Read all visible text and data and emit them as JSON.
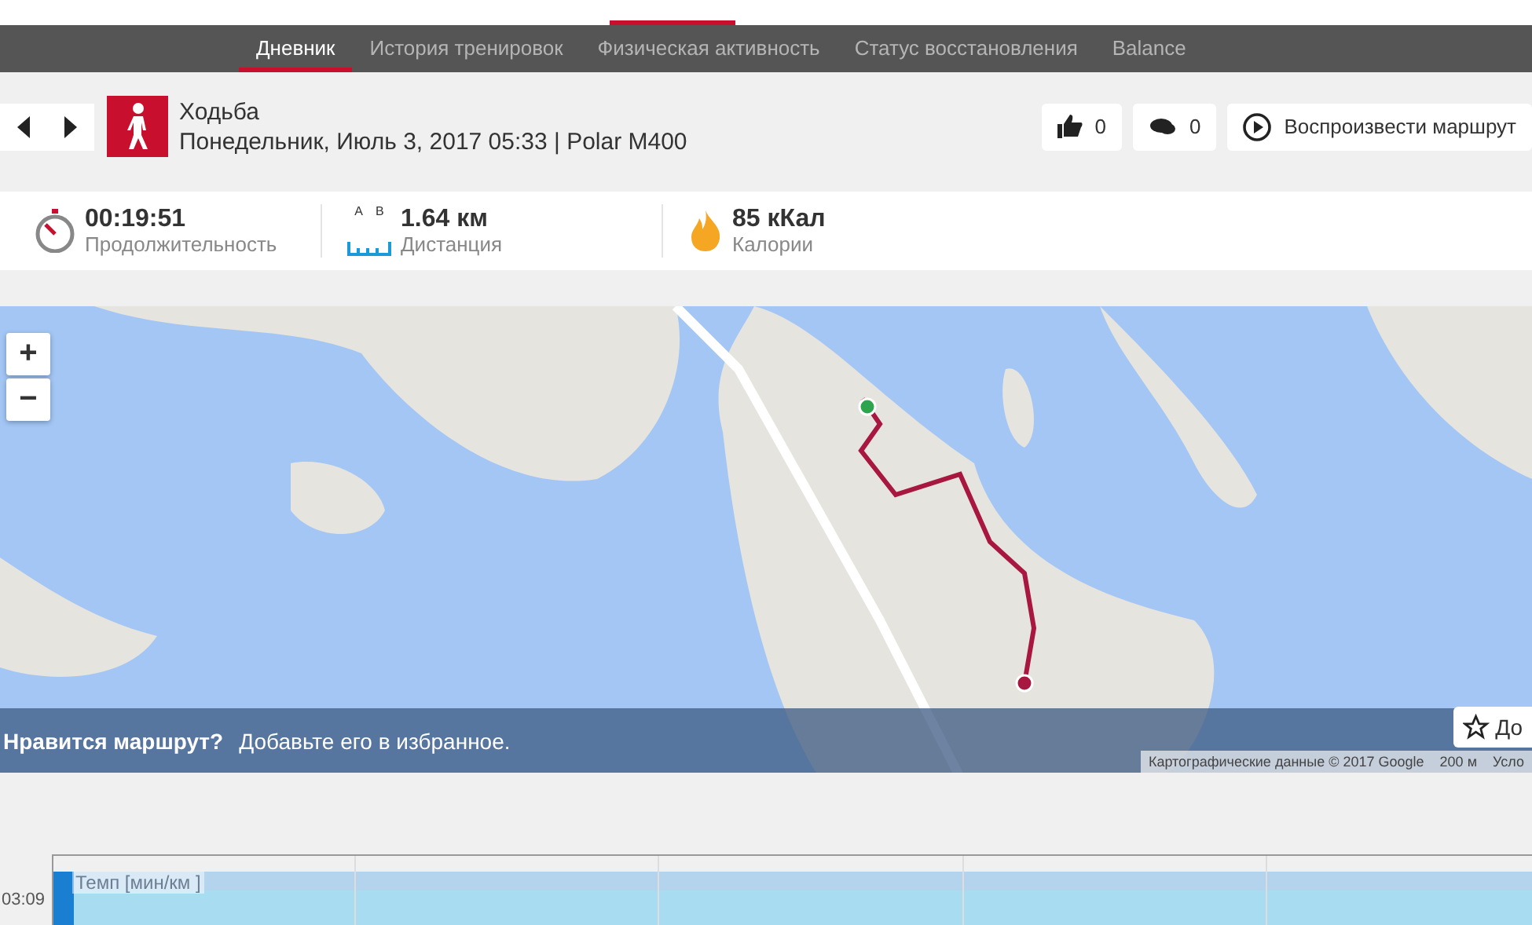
{
  "tabs": [
    {
      "label": "Дневник",
      "selected": true
    },
    {
      "label": "История тренировок",
      "selected": false
    },
    {
      "label": "Физическая активность",
      "selected": false
    },
    {
      "label": "Статус восстановления",
      "selected": false
    },
    {
      "label": "Balance",
      "selected": false
    }
  ],
  "activity": {
    "title": "Ходьба",
    "subtitle": "Понедельник, Июль 3, 2017 05:33 | Polar M400"
  },
  "actions": {
    "likes": "0",
    "comments": "0",
    "replay": "Воспроизвести маршрут"
  },
  "stats": [
    {
      "kind": "duration",
      "value": "00:19:51",
      "label": "Продолжительность"
    },
    {
      "kind": "distance",
      "value": "1.64 км",
      "label": "Дистанция",
      "marks": [
        "A",
        "B"
      ]
    },
    {
      "kind": "calories",
      "value": "85 кКал",
      "label": "Калории"
    }
  ],
  "map": {
    "zoom_in": "+",
    "zoom_out": "−",
    "banner": {
      "question": "Нравится маршрут?",
      "text": "Добавьте его в избранное."
    },
    "favorite_button": "До",
    "attribution": "Картографические данные © 2017 Google",
    "scale": "200 м",
    "terms": "Усло"
  },
  "chart": {
    "series_label": "Темп [мин/км ]",
    "y_label": "03:09"
  }
}
